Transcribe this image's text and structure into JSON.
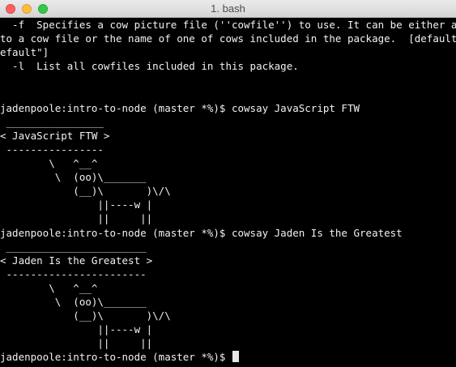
{
  "window": {
    "title": "1. bash"
  },
  "terminal": {
    "lines": [
      "  -f  Specifies a cow picture file (''cowfile'') to use. It can be either a path",
      "to a cow file or the name of one of cows included in the package.  [default: \"d",
      "efault\"]",
      "  -l  List all cowfiles included in this package.",
      "",
      "",
      "jadenpoole:intro-to-node (master *%)$ cowsay JavaScript FTW",
      " ________________",
      "< JavaScript FTW >",
      " ----------------",
      "        \\   ^__^",
      "         \\  (oo)\\_______",
      "            (__)\\       )\\/\\",
      "                ||----w |",
      "                ||     ||",
      "jadenpoole:intro-to-node (master *%)$ cowsay Jaden Is the Greatest",
      " _______________________",
      "< Jaden Is the Greatest >",
      " -----------------------",
      "        \\   ^__^",
      "         \\  (oo)\\_______",
      "            (__)\\       )\\/\\",
      "                ||----w |",
      "                ||     ||"
    ],
    "prompt": "jadenpoole:intro-to-node (master *%)$ "
  }
}
